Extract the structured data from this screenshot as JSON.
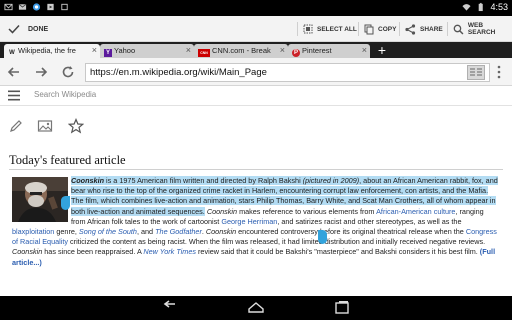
{
  "status_bar": {
    "time": "4:53"
  },
  "action_bar": {
    "done_label": "DONE",
    "select_all_label": "SELECT ALL",
    "copy_label": "COPY",
    "share_label": "SHARE",
    "web_search_label": "WEB SEARCH"
  },
  "tabs": [
    {
      "title": "Wikipedia, the fre",
      "favicon": "W"
    },
    {
      "title": "Yahoo",
      "favicon": "Y"
    },
    {
      "title": "CNN.com - Break",
      "favicon": "CNN"
    },
    {
      "title": "Pinterest",
      "favicon": "P"
    }
  ],
  "toolbar": {
    "url": "https://en.m.wikipedia.org/wiki/Main_Page"
  },
  "wiki": {
    "search_placeholder": "Search Wikipedia",
    "heading": "Today's featured article",
    "p1_sel_a": "Coonskin",
    "p1_sel_b": " is a 1975 American film written and directed by Ralph Bakshi ",
    "p1_sel_c": "(pictured",
    "p1_sel_d": " in 2009)",
    "p1_sel_e": ", about an African American rabbit, fox, and bear who rise to the top of the organized crime racket in Harlem, encountering corrupt law enforcement, con artists, and the Mafia. The film, which combines live-action and animation, stars Philip Thomas, Barry White, and Scat Man Crothers, all of whom appear in both live-action and animated sequences.",
    "p1_t1": " ",
    "p1_t2": "Coonskin",
    "p1_t3": " makes reference to various elements from ",
    "p1_l1": "African-American culture",
    "p1_t4": ", ranging from African folk tales to the work of cartoonist ",
    "p1_l2": "George Herriman",
    "p1_t5": ", and satirizes racist and other stereotypes, as well as the ",
    "p1_l3": "blaxploitation",
    "p1_t6": " genre, ",
    "p1_l4": "Song of the South",
    "p1_t7": ", and ",
    "p1_l5": "The Godfather",
    "p1_t8": ". ",
    "p1_t9": "Coonskin",
    "p1_t10": " encountered controversy before its original theatrical release when the ",
    "p1_l6": "Congress of Racial Equality",
    "p1_t11": " criticized the content as being racist. When the film was released, it had limited distribution and initially received negative reviews. ",
    "p1_t12": "Coonskin",
    "p1_t13": " has since been reappraised. A ",
    "p1_l7": "New York Times",
    "p1_t14": " review said that it could be Bakshi's \"masterpiece\" and Bakshi considers it his best film. ",
    "p1_l8": "(Full article...)"
  },
  "colors": {
    "selection": "#b3dcf3",
    "handle": "#33a3dc",
    "link": "#2a5db0"
  }
}
